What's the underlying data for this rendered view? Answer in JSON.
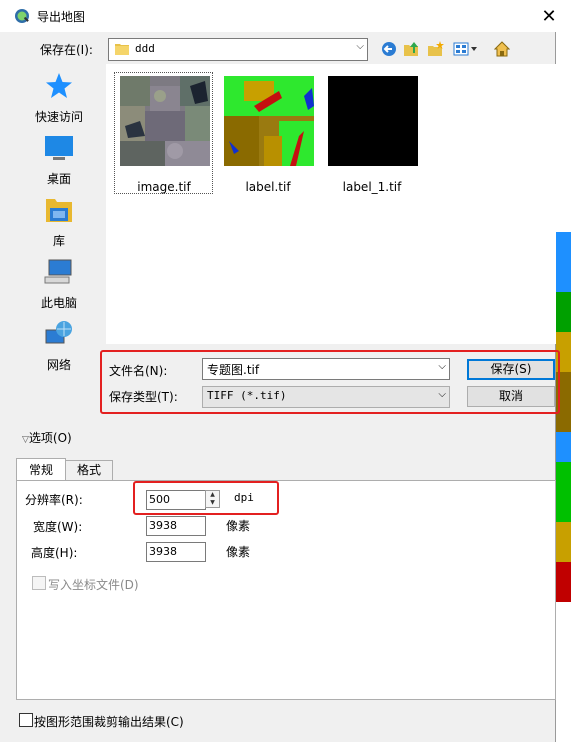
{
  "window": {
    "title": "导出地图"
  },
  "toolbar": {
    "save_in_label": "保存在(I):",
    "save_in_value": "ddd",
    "icons": [
      "back-icon",
      "up-folder-icon",
      "new-folder-icon",
      "view-menu-icon",
      "home-icon"
    ]
  },
  "places": [
    {
      "label": "快速访问",
      "icon": "star-icon"
    },
    {
      "label": "桌面",
      "icon": "desktop-icon"
    },
    {
      "label": "库",
      "icon": "library-icon"
    },
    {
      "label": "此电脑",
      "icon": "computer-icon"
    },
    {
      "label": "网络",
      "icon": "network-icon"
    }
  ],
  "files": [
    {
      "name": "image.tif",
      "selected": true
    },
    {
      "name": "label.tif",
      "selected": false
    },
    {
      "name": "label_1.tif",
      "selected": false
    }
  ],
  "form": {
    "filename_label": "文件名(N):",
    "filename_value": "专题图.tif",
    "filetype_label": "保存类型(T):",
    "filetype_value": "TIFF (*.tif)",
    "save_button": "保存(S)",
    "cancel_button": "取消"
  },
  "options": {
    "toggle_label": "选项(O)",
    "tabs": [
      "常规",
      "格式"
    ],
    "resolution_label": "分辨率(R):",
    "resolution_value": "500",
    "resolution_unit": "dpi",
    "width_label": "宽度(W):",
    "width_value": "3938",
    "width_unit": "像素",
    "height_label": "高度(H):",
    "height_value": "3938",
    "height_unit": "像素",
    "world_file_label": "写入坐标文件(D)",
    "clip_label": "按图形范围裁剪输出结果(C)"
  },
  "colors": {
    "accent": "#0078d7",
    "highlight_box": "#e32020",
    "star": "#1e90ff"
  }
}
